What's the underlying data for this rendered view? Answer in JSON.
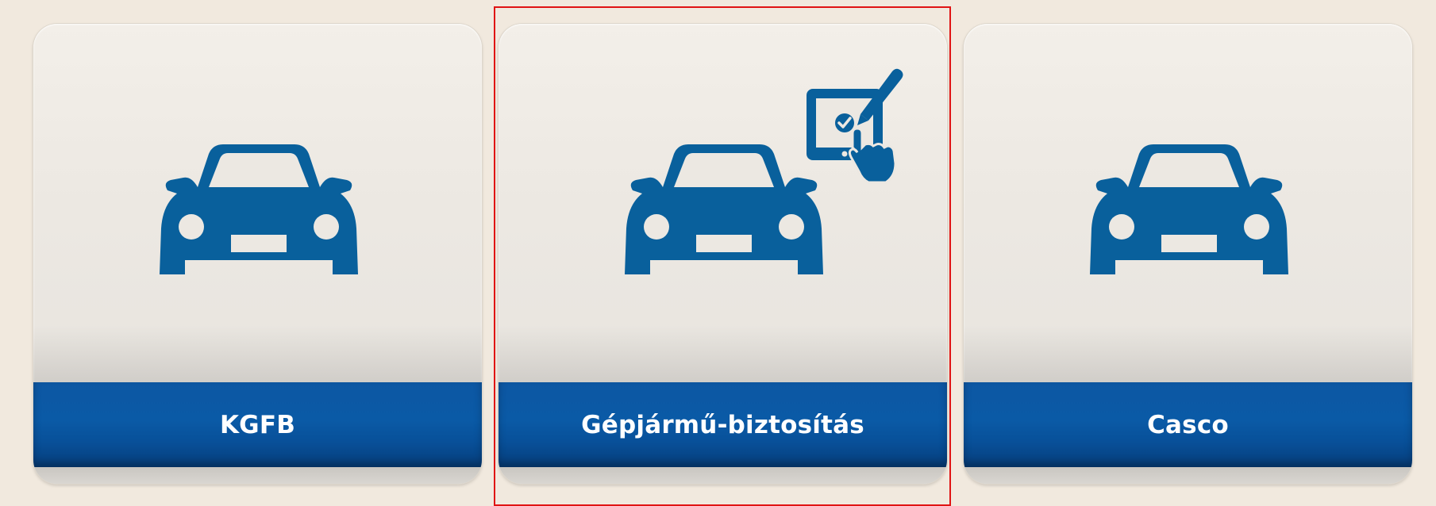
{
  "colors": {
    "background": "#f1e9de",
    "accent_blue": "#0a5aa6",
    "icon_blue": "#09609c",
    "selection_red": "#e01414"
  },
  "cards": [
    {
      "label": "KGFB",
      "icon": "car-icon",
      "selected": false
    },
    {
      "label": "Gépjármű-biztosítás",
      "icon": "car-icon",
      "badge_icon": "tablet-signature-icon",
      "selected": true
    },
    {
      "label": "Casco",
      "icon": "car-icon",
      "selected": false
    }
  ]
}
